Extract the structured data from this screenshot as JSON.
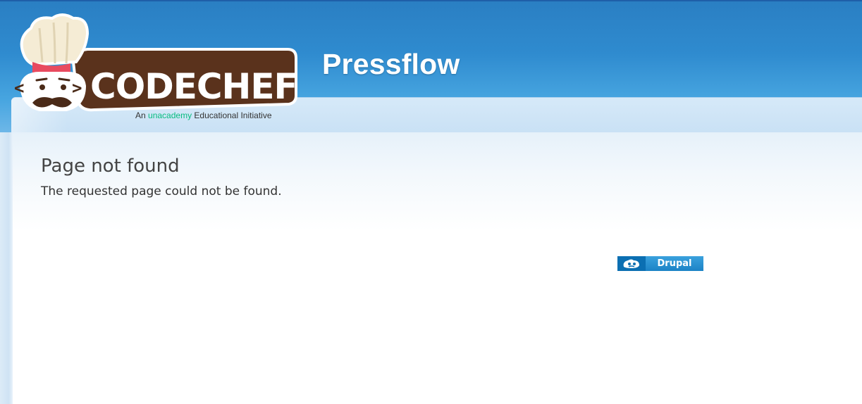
{
  "header": {
    "site_name": "Pressflow",
    "logo": {
      "wordmark": "CODECHEF",
      "tagline_prefix": "An",
      "tagline_brand": "unacademy",
      "tagline_suffix": "Educational Initiative"
    }
  },
  "main": {
    "title": "Page not found",
    "message": "The requested page could not be found."
  },
  "footer": {
    "powered_by_label": "Drupal"
  },
  "colors": {
    "header_blue": "#2f8bcf",
    "logo_brown": "#5a321c",
    "hat_red": "#e84a5f",
    "unacademy_green": "#08bd80",
    "drupal_blue": "#0b6fb2"
  },
  "icons": {
    "logo": "codechef-chef-hat-logo",
    "drupal": "drupal-drop-icon"
  }
}
